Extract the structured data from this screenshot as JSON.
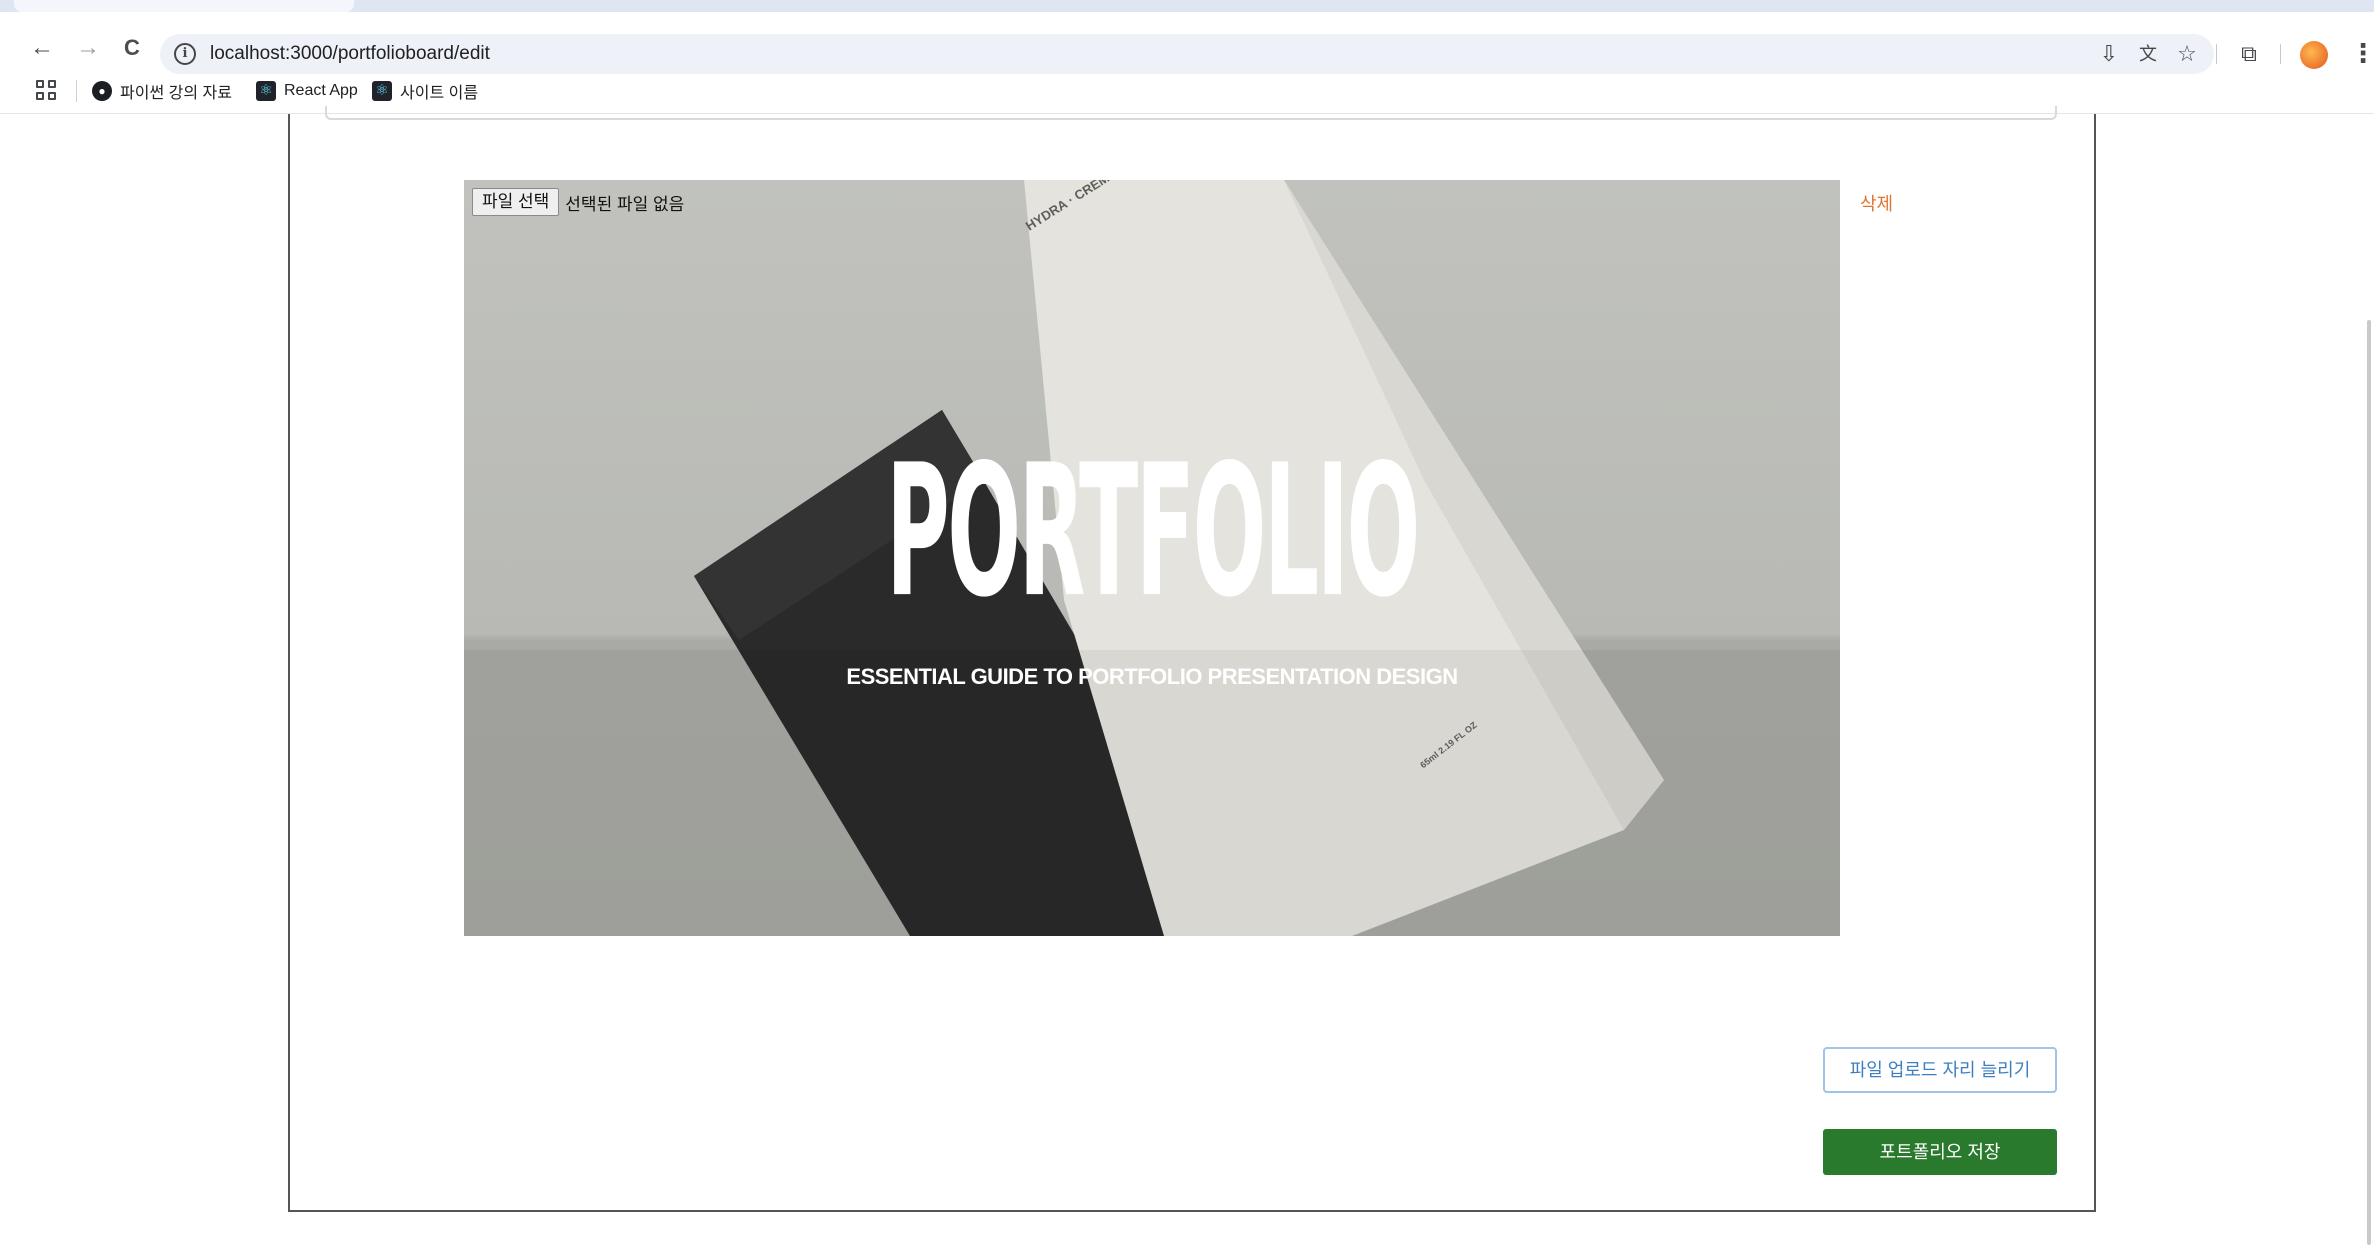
{
  "browser": {
    "url": "localhost:3000/portfolioboard/edit",
    "nav": {
      "back": "←",
      "forward": "→",
      "reload": "C"
    },
    "toolbar_icons": [
      "install-icon",
      "translate-icon",
      "star-icon",
      "extensions-icon",
      "profile-avatar",
      "menu-icon"
    ],
    "bookmarks": [
      {
        "label": "파이썬 강의 자료",
        "icon": "github-icon"
      },
      {
        "label": "React App",
        "icon": "react-icon"
      },
      {
        "label": "사이트 이름",
        "icon": "react-icon"
      }
    ]
  },
  "editor": {
    "file_input": {
      "button_label": "파일 선택",
      "status": "선택된 파일 없음"
    },
    "delete_label": "삭제",
    "preview": {
      "title": "PORTFOLIO",
      "subtitle": "ESSENTIAL GUIDE TO PORTFOLIO PRESENTATION DESIGN"
    },
    "expand_upload_label": "파일 업로드 자리 늘리기",
    "save_label": "포트폴리오 저장"
  },
  "colors": {
    "delete": "#e0762e",
    "save_button": "#2a7a2e",
    "expand_button_border": "#9fc4e6",
    "expand_button_text": "#3d7fc1"
  }
}
